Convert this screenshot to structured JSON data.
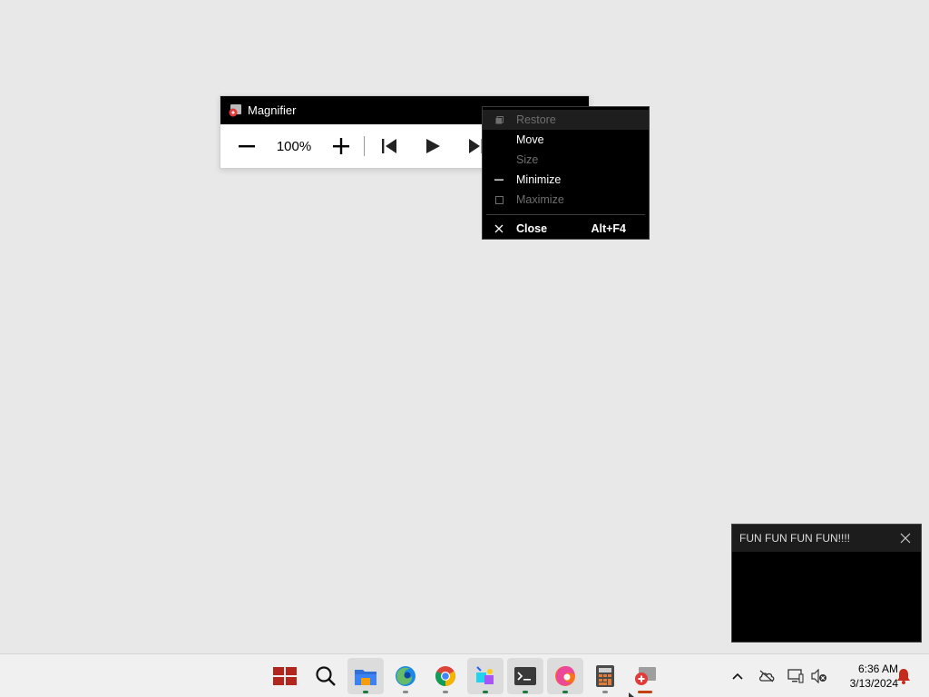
{
  "magnifier": {
    "title": "Magnifier",
    "zoom_level": "100%",
    "icons": [
      "zoom-out-icon",
      "zoom-in-icon",
      "previous-icon",
      "play-icon",
      "next-icon"
    ]
  },
  "context_menu": {
    "items": [
      {
        "label": "Restore",
        "enabled": false,
        "icon": "restore-icon"
      },
      {
        "label": "Move",
        "enabled": true
      },
      {
        "label": "Size",
        "enabled": false
      },
      {
        "label": "Minimize",
        "enabled": true,
        "icon": "minimize-icon"
      },
      {
        "label": "Maximize",
        "enabled": false,
        "icon": "maximize-icon"
      },
      {
        "label": "Close",
        "enabled": true,
        "icon": "close-icon",
        "accelerator": "Alt+F4"
      }
    ]
  },
  "notification": {
    "title": "FUN FUN FUN FUN!!!!"
  },
  "taskbar": {
    "apps": [
      "start",
      "search",
      "file-explorer",
      "firefox",
      "chrome",
      "media-editor",
      "terminal",
      "edge",
      "calculator",
      "magnifier"
    ],
    "clock": {
      "time": "6:36 AM",
      "date": "3/13/2024"
    }
  },
  "colors": {
    "desktop": "#e8e8e8",
    "titlebar": "#000000",
    "accent_red": "#c42b1c",
    "active_indicator": "#1a7a3a"
  }
}
